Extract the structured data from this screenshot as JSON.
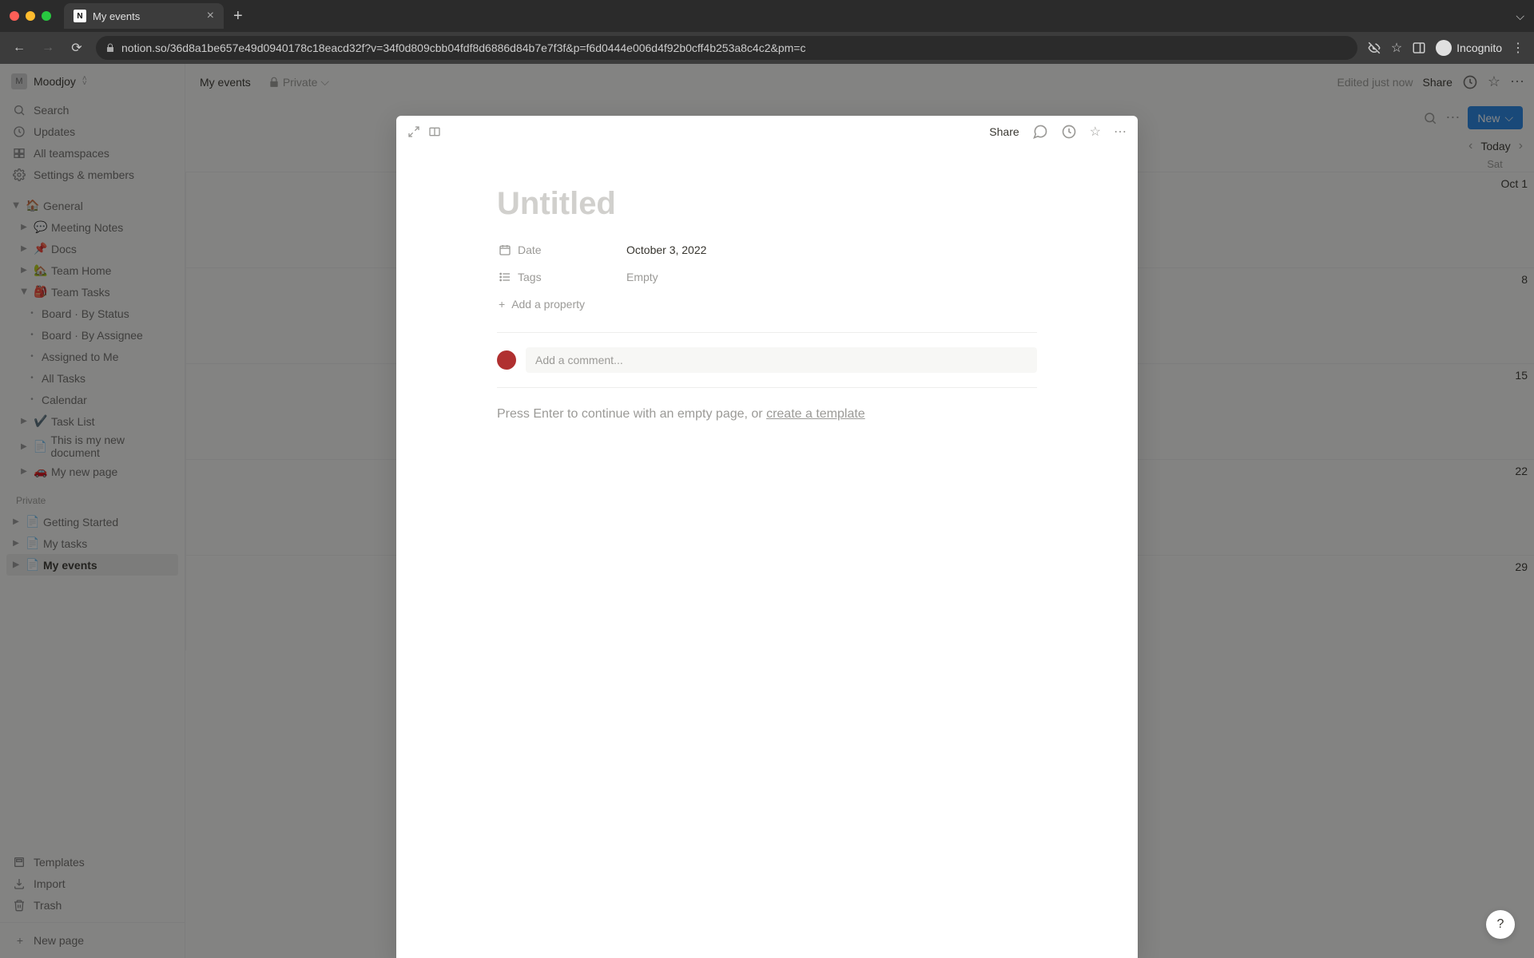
{
  "browser": {
    "tab_title": "My events",
    "url": "notion.so/36d8a1be657e49d0940178c18eacd32f?v=34f0d809cbb04fdf8d6886d84b7e7f3f&p=f6d0444e006d4f92b0cff4b253a8c4c2&pm=c",
    "incognito_label": "Incognito"
  },
  "workspace": {
    "initial": "M",
    "name": "Moodjoy"
  },
  "sidebar": {
    "search": "Search",
    "updates": "Updates",
    "teamspaces": "All teamspaces",
    "settings": "Settings & members",
    "section_private": "Private"
  },
  "pages": {
    "general": "General",
    "meeting_notes": "Meeting Notes",
    "docs": "Docs",
    "team_home": "Team Home",
    "team_tasks": "Team Tasks",
    "board_status": "Board · By Status",
    "board_assignee": "Board · By Assignee",
    "assigned_me": "Assigned to Me",
    "all_tasks": "All Tasks",
    "calendar": "Calendar",
    "task_list": "Task List",
    "new_doc": "This is my new document",
    "my_new_page": "My new page",
    "getting_started": "Getting Started",
    "my_tasks": "My tasks",
    "my_events": "My events"
  },
  "sidebar_bottom": {
    "templates": "Templates",
    "import": "Import",
    "trash": "Trash",
    "new_page": "New page"
  },
  "topbar": {
    "breadcrumb": "My events",
    "privacy": "Private",
    "edited": "Edited just now",
    "share": "Share"
  },
  "calendar": {
    "new_btn": "New",
    "today": "Today",
    "day_label": "Sat",
    "dates": [
      "Oct 1",
      "8",
      "15",
      "22",
      "29"
    ]
  },
  "modal": {
    "share": "Share",
    "title_placeholder": "Untitled",
    "date_label": "Date",
    "date_value": "October 3, 2022",
    "tags_label": "Tags",
    "tags_value": "Empty",
    "add_property": "Add a property",
    "comment_placeholder": "Add a comment...",
    "empty_hint_prefix": "Press Enter to continue with an empty page, or ",
    "template_link": "create a template"
  },
  "help": "?"
}
